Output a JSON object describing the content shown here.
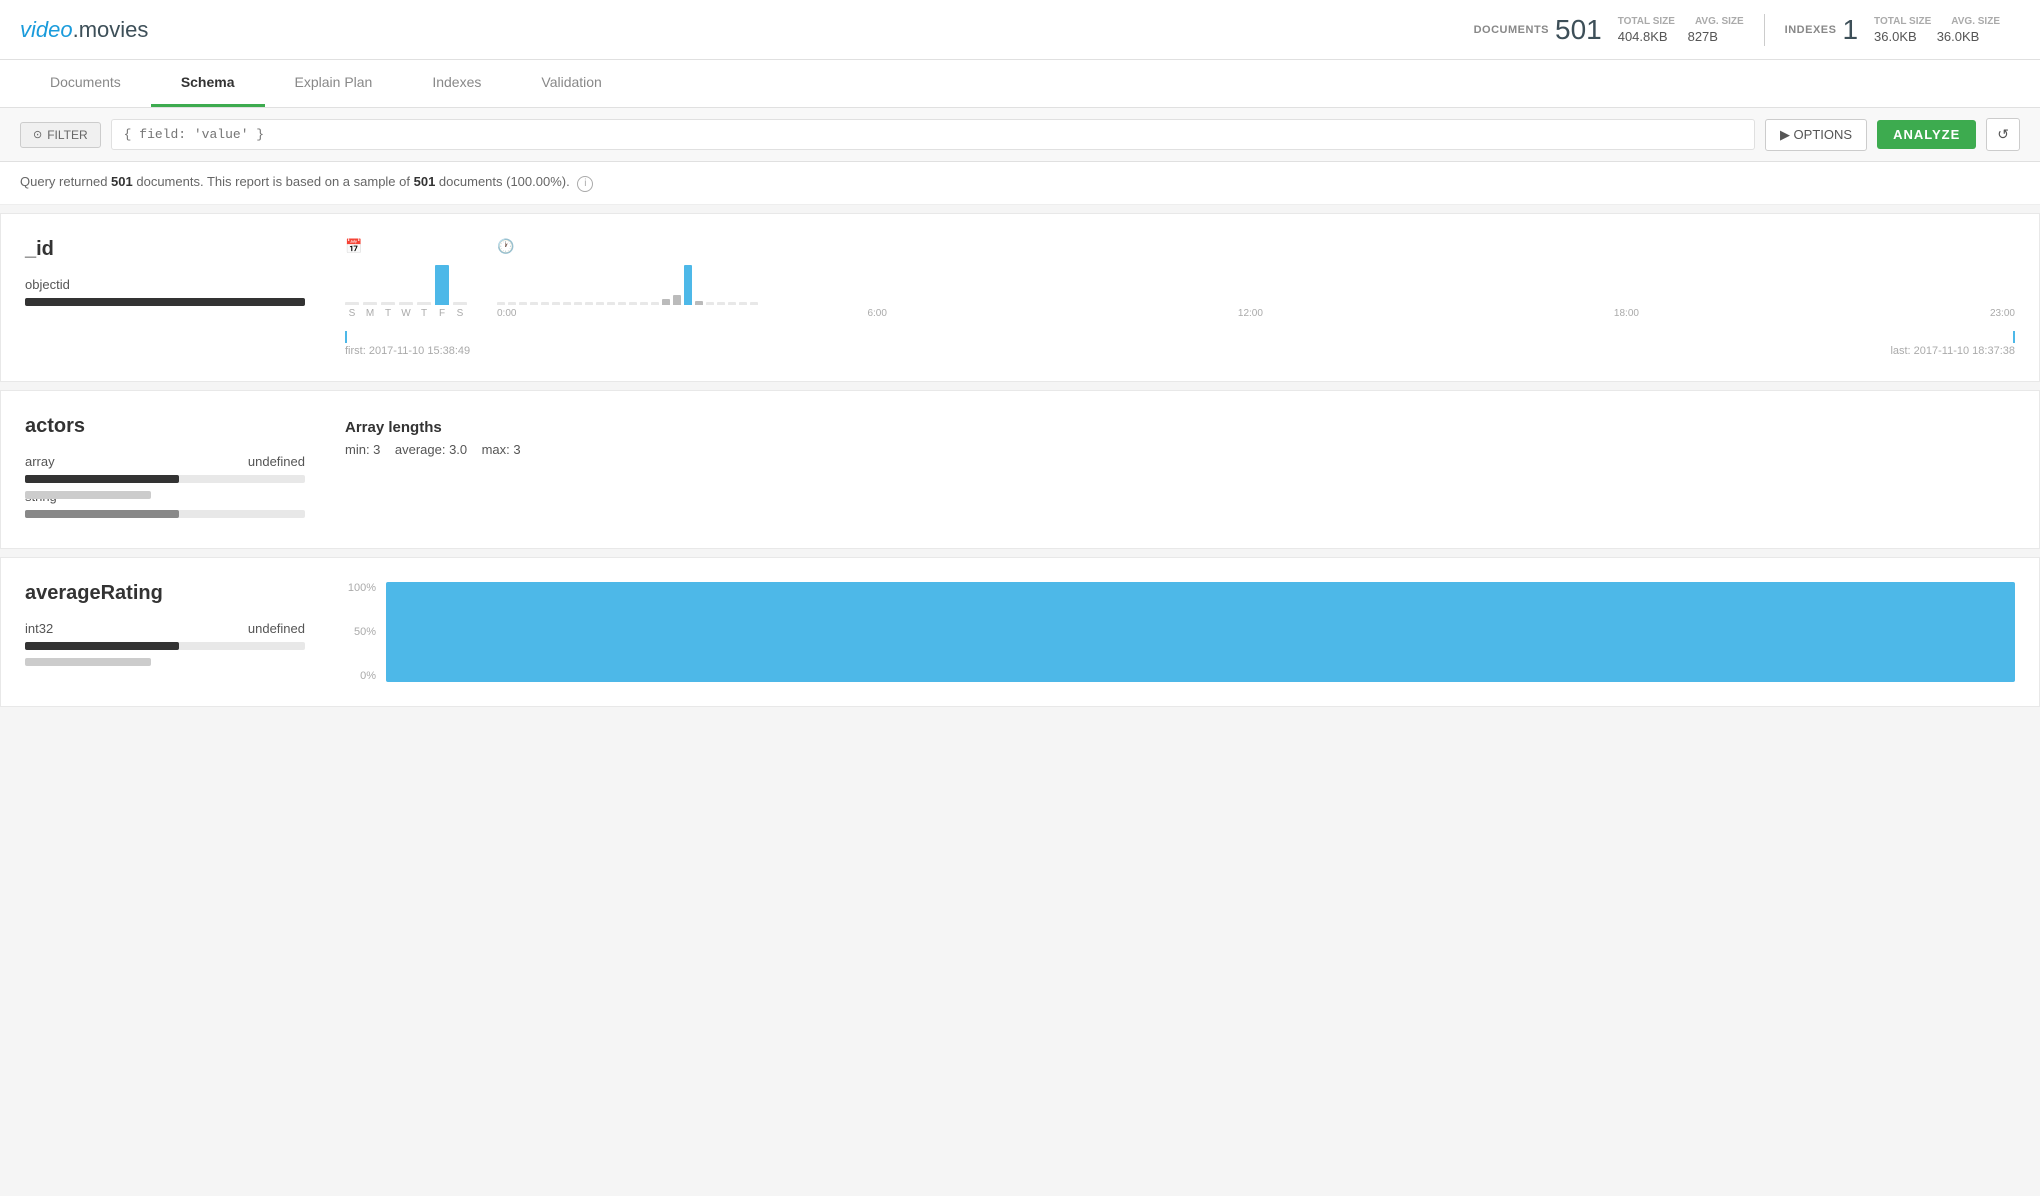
{
  "header": {
    "logo_video": "video",
    "logo_dot": ".",
    "logo_movies": "movies",
    "documents_label": "DOCUMENTS",
    "documents_value": "501",
    "total_size_label": "TOTAL SIZE",
    "total_size_value": "404.8KB",
    "avg_size_label": "AVG. SIZE",
    "avg_size_value": "827B",
    "indexes_label": "INDEXES",
    "indexes_value": "1",
    "indexes_total_size_label": "TOTAL SIZE",
    "indexes_total_size_value": "36.0KB",
    "indexes_avg_size_label": "AVG. SIZE",
    "indexes_avg_size_value": "36.0KB"
  },
  "tabs": [
    {
      "id": "documents",
      "label": "Documents",
      "active": false
    },
    {
      "id": "schema",
      "label": "Schema",
      "active": true
    },
    {
      "id": "explain-plan",
      "label": "Explain Plan",
      "active": false
    },
    {
      "id": "indexes",
      "label": "Indexes",
      "active": false
    },
    {
      "id": "validation",
      "label": "Validation",
      "active": false
    }
  ],
  "filter": {
    "filter_btn_label": "FILTER",
    "filter_placeholder": "{ field: 'value' }",
    "options_label": "▶ OPTIONS",
    "analyze_label": "ANALYZE",
    "refresh_label": "↺"
  },
  "status": {
    "text_prefix": "Query returned ",
    "count1": "501",
    "text_middle": " documents. This report is based on a sample of ",
    "count2": "501",
    "text_suffix": " documents (100.00%)."
  },
  "fields": [
    {
      "name": "_id",
      "types": [
        {
          "label": "objectid",
          "bar_pct": 100,
          "bar_type": "dark"
        }
      ],
      "has_date_chart": true,
      "dow": {
        "days": [
          "S",
          "M",
          "T",
          "W",
          "T",
          "F",
          "S"
        ],
        "heights": [
          0,
          0,
          0,
          0,
          0,
          38,
          0
        ],
        "highlight_idx": 5
      },
      "tod": {
        "heights": [
          0,
          0,
          0,
          0,
          0,
          0,
          0,
          0,
          0,
          0,
          0,
          0,
          0,
          0,
          0,
          5,
          8,
          38,
          3,
          2,
          0,
          0,
          0,
          0
        ],
        "labels": [
          "0:00",
          "6:00",
          "12:00",
          "18:00",
          "23:00"
        ],
        "highlight_idx": 17
      },
      "first_date": "first: 2017-11-10 15:38:49",
      "last_date": "last: 2017-11-10 18:37:38"
    },
    {
      "name": "actors",
      "types": [
        {
          "label": "array",
          "bar_pct": 55,
          "bar_type": "dark",
          "right_label": "undefined",
          "right_bar_pct": 45,
          "right_bar_type": "light"
        },
        {
          "label": "string",
          "bar_pct": 55,
          "bar_type": "medium"
        }
      ],
      "has_array_lengths": true,
      "array_min": "3",
      "array_avg": "3.0",
      "array_max": "3"
    },
    {
      "name": "averageRating",
      "types": [
        {
          "label": "int32",
          "bar_pct": 55,
          "bar_type": "dark",
          "right_label": "undefined",
          "right_bar_pct": 45,
          "right_bar_type": "light"
        }
      ],
      "has_bar_chart": true,
      "chart_pct_100": "100%",
      "chart_pct_50": "50%",
      "chart_pct_0": "0%",
      "bar_fill_pct": 100
    }
  ]
}
